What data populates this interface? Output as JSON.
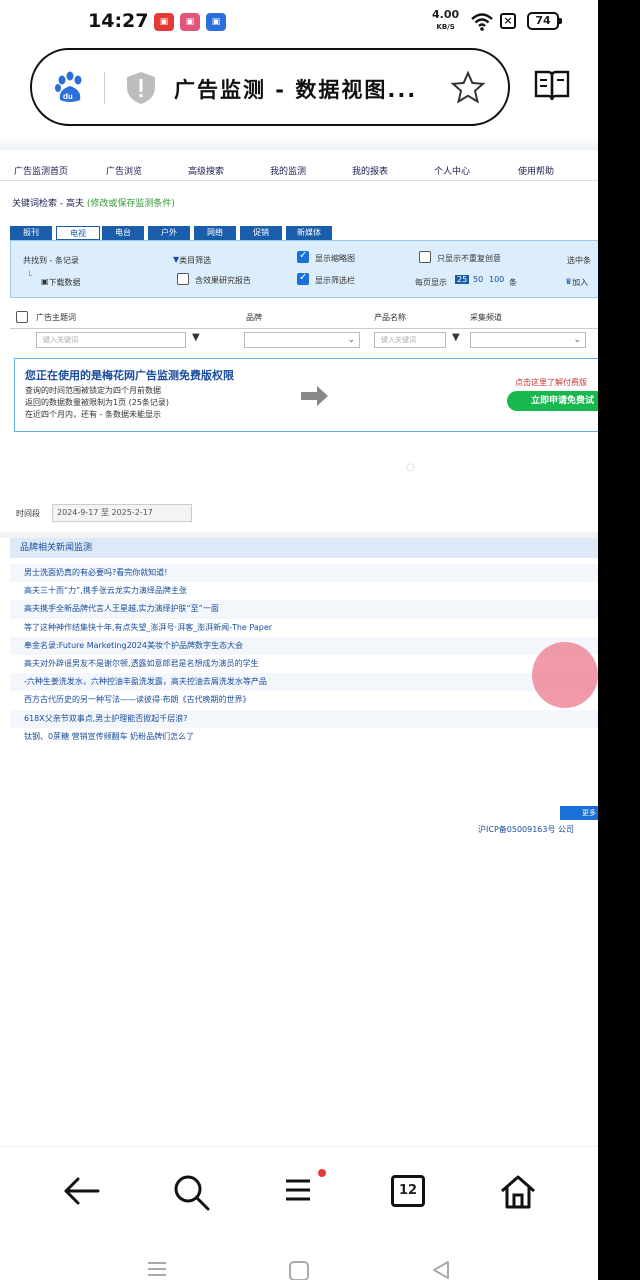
{
  "status_bar": {
    "time": "14:27",
    "net_speed": "4.00",
    "net_unit": "KB/S",
    "battery": "74"
  },
  "address_bar": {
    "page_title": "广告监测 - 数据视图..."
  },
  "site": {
    "nav_items": [
      "广告监测首页",
      "广告浏览",
      "高级搜索",
      "我的监测",
      "我的报表",
      "个人中心",
      "使用帮助"
    ],
    "keyword_label": "关键词检索 - 高夫",
    "keyword_link": "(修改或保存监测条件)",
    "media_tabs": [
      "报刊",
      "电视",
      "电台",
      "户外",
      "网络",
      "促销",
      "新媒体"
    ],
    "filter": {
      "total": "共找到 - 条记录",
      "item_filter": "类目筛选",
      "show_thumb": "显示缩略图",
      "no_dup": "只显示不重复创意",
      "download": "下载数据",
      "include_research": "含效果研究报告",
      "show_filter_bar": "显示筛选栏",
      "per_page_label": "每页显示",
      "per_page_options": [
        "25",
        "50",
        "100"
      ],
      "per_page_unit": "条",
      "selected_prefix": "选中条",
      "add": "加入"
    },
    "table_headers": {
      "subject": "广告主题词",
      "brand": "品牌",
      "product": "产品名称",
      "channel": "采集频道"
    },
    "search_placeholder": "键入关键词",
    "promo": {
      "heading": "您正在使用的是梅花网广告监测免费版权限",
      "lines": [
        "查询的时间范围被锁定为四个月前数据",
        "返回的数据数量被限制为1页 (25条记录)",
        "在近四个月内，还有 - 条数据未能显示"
      ],
      "right_text": "点击这里了解付费版",
      "button": "立即申请免费试"
    },
    "period_label": "时间段",
    "period_value": "2024-9-17 至 2025-2-17",
    "news_header": "品牌相关新闻监测",
    "news_items": [
      "男士洗面奶真的有必要吗?看完你就知道!",
      "高夫三十而“力”,携手张云龙实力演绎品牌主张",
      "高夫携手全新品牌代言人王星越,实力演绎护肤“至”一面",
      "等了这种神作结集快十年,有点失望_澎湃号·湃客_澎湃新闻-The Paper",
      "奉金名录:Future Marketing2024美妆个护品牌数字生态大会",
      "高夫对外辟谣男友不是谢尔顿,透露如意郎君是名想成为演员的学生",
      "-六种生姜洗发水，六种控油丰盈洗发露，高夫控油去屑洗发水等产品",
      "西方古代历史的另一种写法——读彼得·布朗《古代晚期的世界》",
      "618X父亲节双事点,男士护理能否掀起千层浪?",
      "钛钢、0蔗糖 营销宣传频翻车 奶粉品牌们怎么了"
    ],
    "more": "更多",
    "icp": "沪ICP备05009163号   公司"
  },
  "toolbar": {
    "tab_count": "12"
  },
  "colors": {
    "accent": "#1a5dab",
    "filter_bg": "#dceefb",
    "promo_button": "#17b84e",
    "float_button": "#ec788c"
  }
}
